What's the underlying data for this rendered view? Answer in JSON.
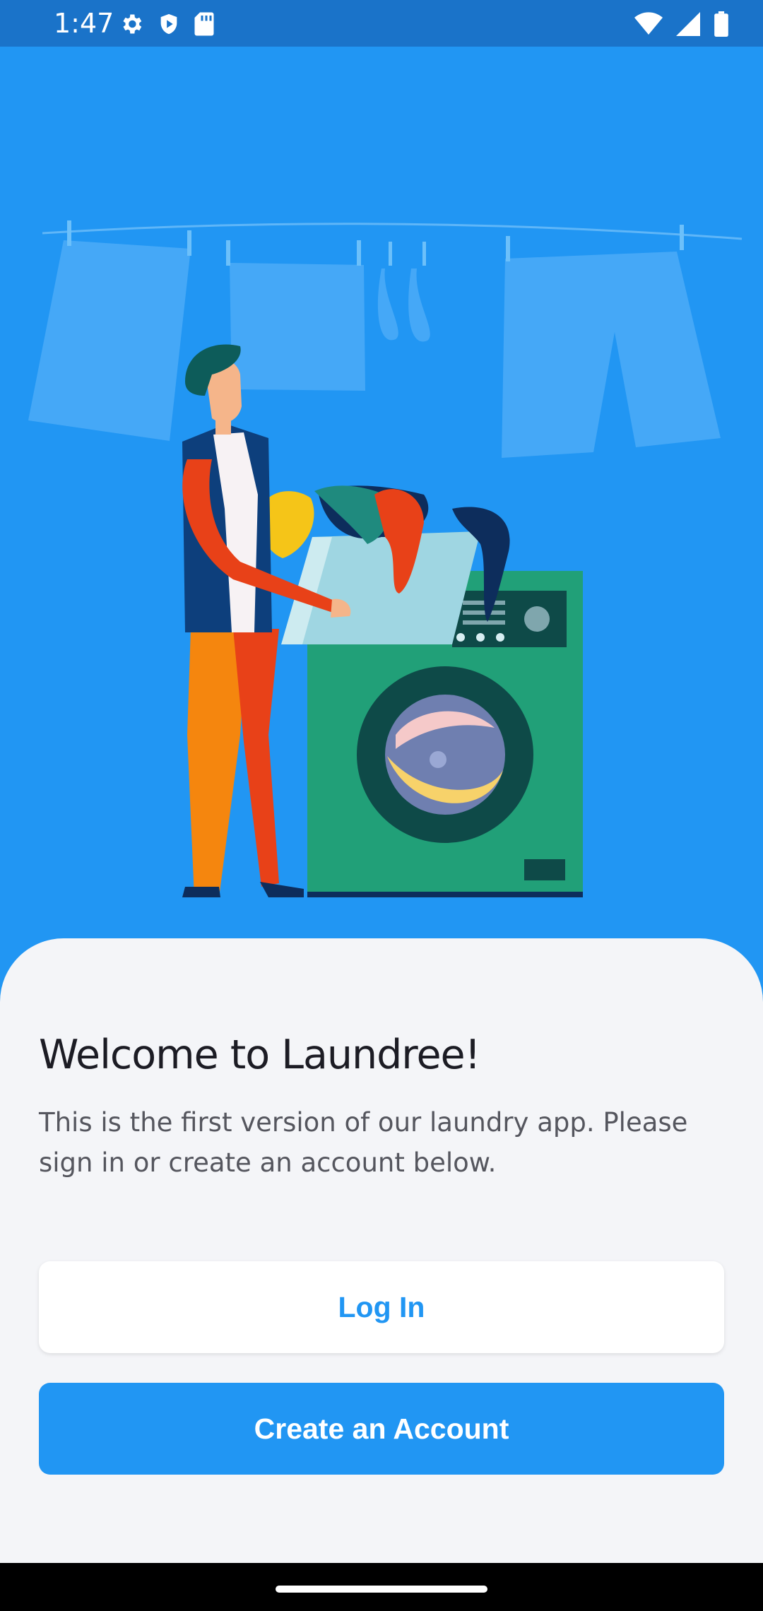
{
  "status_bar": {
    "time": "1:47",
    "left_icons": [
      "settings-gear-icon",
      "play-shield-icon",
      "sd-card-icon"
    ],
    "right_icons": [
      "wifi-icon",
      "cellular-signal-icon",
      "battery-icon"
    ]
  },
  "hero": {
    "illustration": "person-loading-washing-machine-illustration",
    "colors": {
      "background": "#2196f3",
      "washer": "#21a078",
      "clothes_line_items": "#45a8f7"
    }
  },
  "welcome": {
    "title": "Welcome to Laundree!",
    "description": "This is the first version of our laundry app. Please sign in or create an account below."
  },
  "actions": {
    "login_label": "Log In",
    "create_account_label": "Create an Account"
  },
  "colors": {
    "primary": "#2196f3",
    "sheet_background": "#f4f5f8",
    "title_text": "#1c1c24",
    "body_text": "#55565e"
  }
}
